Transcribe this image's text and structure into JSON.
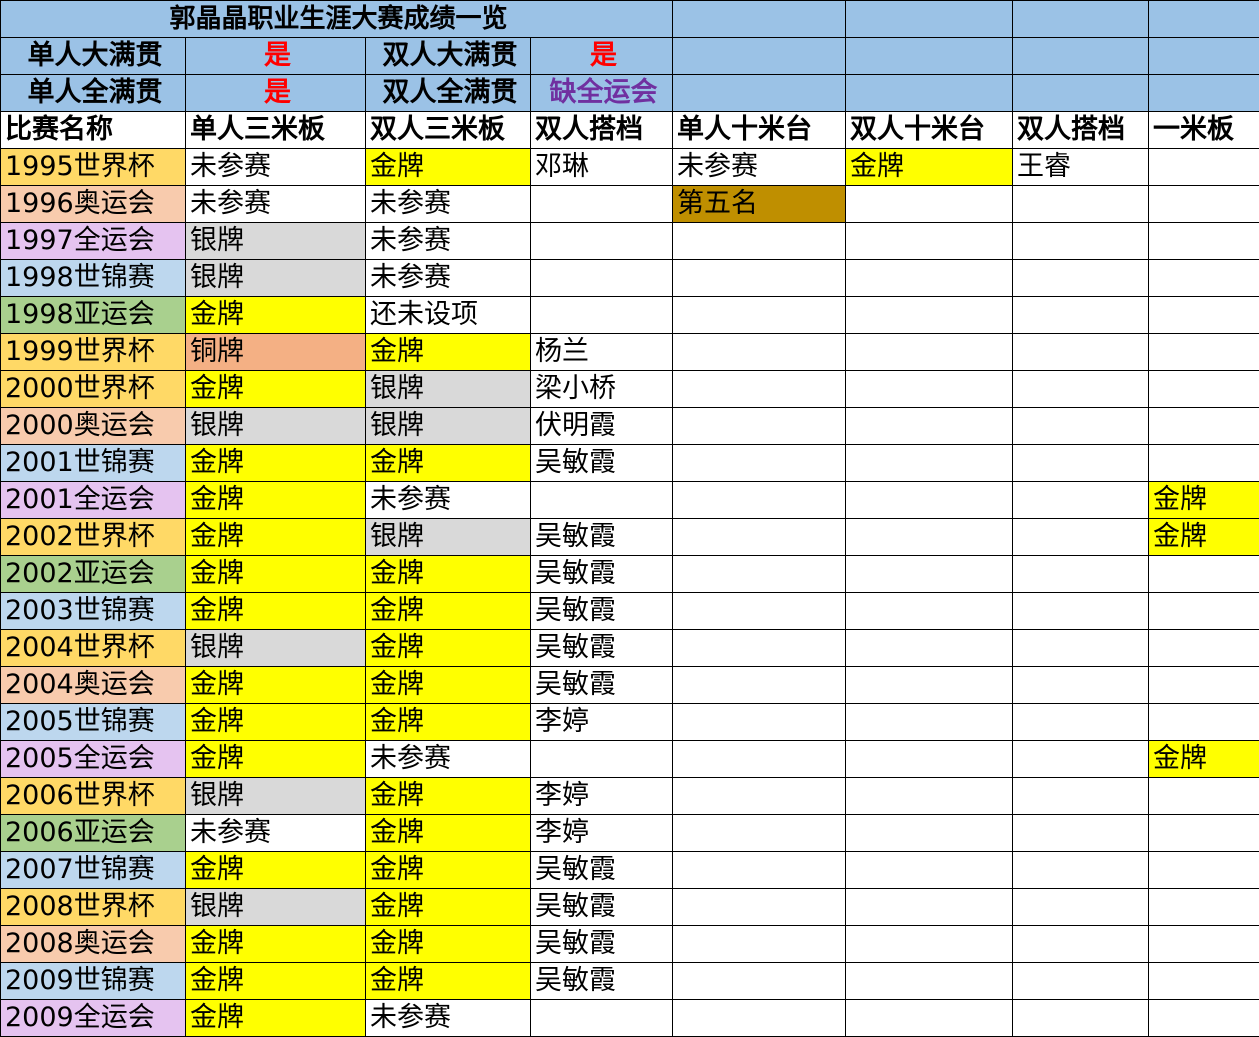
{
  "title": "郭晶晶职业生涯大赛成绩一览",
  "summary": [
    {
      "label1": "单人大满贯",
      "value1": "是",
      "label2": "双人大满贯",
      "value2": "是",
      "value2_color": "red"
    },
    {
      "label1": "单人全满贯",
      "value1": "是",
      "label2": "双人全满贯",
      "value2": "缺全运会",
      "value2_color": "purple"
    }
  ],
  "columns": [
    "比赛名称",
    "单人三米板",
    "双人三米板",
    "双人搭档",
    "单人十米台",
    "双人十米台",
    "双人搭档",
    "一米板"
  ],
  "colors": {
    "header_blue": "#9bc2e6",
    "gold": "#ffff00",
    "silver": "#d9d9d9",
    "bronze": "#f4b084",
    "fifth": "#bf8f00",
    "world_cup": "#ffd966",
    "olympics": "#f8cbad",
    "national_games": "#e5c3f0",
    "world_championships": "#bdd7ee",
    "asian_games": "#a9d08e"
  },
  "rows": [
    {
      "event": "1995世界杯",
      "cells": [
        "未参赛",
        "金牌",
        "邓琳",
        "未参赛",
        "金牌",
        "王睿",
        ""
      ]
    },
    {
      "event": "1996奥运会",
      "cells": [
        "未参赛",
        "未参赛",
        "",
        "第五名",
        "",
        "",
        ""
      ]
    },
    {
      "event": "1997全运会",
      "cells": [
        "银牌",
        "未参赛",
        "",
        "",
        "",
        "",
        ""
      ]
    },
    {
      "event": "1998世锦赛",
      "cells": [
        "银牌",
        "未参赛",
        "",
        "",
        "",
        "",
        ""
      ]
    },
    {
      "event": "1998亚运会",
      "cells": [
        "金牌",
        "还未设项",
        "",
        "",
        "",
        "",
        ""
      ]
    },
    {
      "event": "1999世界杯",
      "cells": [
        "铜牌",
        "金牌",
        "杨兰",
        "",
        "",
        "",
        ""
      ]
    },
    {
      "event": "2000世界杯",
      "cells": [
        "金牌",
        "银牌",
        "梁小桥",
        "",
        "",
        "",
        ""
      ]
    },
    {
      "event": "2000奥运会",
      "cells": [
        "银牌",
        "银牌",
        "伏明霞",
        "",
        "",
        "",
        ""
      ]
    },
    {
      "event": "2001世锦赛",
      "cells": [
        "金牌",
        "金牌",
        "吴敏霞",
        "",
        "",
        "",
        ""
      ]
    },
    {
      "event": "2001全运会",
      "cells": [
        "金牌",
        "未参赛",
        "",
        "",
        "",
        "",
        "金牌"
      ]
    },
    {
      "event": "2002世界杯",
      "cells": [
        "金牌",
        "银牌",
        "吴敏霞",
        "",
        "",
        "",
        "金牌"
      ]
    },
    {
      "event": "2002亚运会",
      "cells": [
        "金牌",
        "金牌",
        "吴敏霞",
        "",
        "",
        "",
        ""
      ]
    },
    {
      "event": "2003世锦赛",
      "cells": [
        "金牌",
        "金牌",
        "吴敏霞",
        "",
        "",
        "",
        ""
      ]
    },
    {
      "event": "2004世界杯",
      "cells": [
        "银牌",
        "金牌",
        "吴敏霞",
        "",
        "",
        "",
        ""
      ]
    },
    {
      "event": "2004奥运会",
      "cells": [
        "金牌",
        "金牌",
        "吴敏霞",
        "",
        "",
        "",
        ""
      ]
    },
    {
      "event": "2005世锦赛",
      "cells": [
        "金牌",
        "金牌",
        "李婷",
        "",
        "",
        "",
        ""
      ]
    },
    {
      "event": "2005全运会",
      "cells": [
        "金牌",
        "未参赛",
        "",
        "",
        "",
        "",
        "金牌"
      ]
    },
    {
      "event": "2006世界杯",
      "cells": [
        "银牌",
        "金牌",
        "李婷",
        "",
        "",
        "",
        ""
      ]
    },
    {
      "event": "2006亚运会",
      "cells": [
        "未参赛",
        "金牌",
        "李婷",
        "",
        "",
        "",
        ""
      ]
    },
    {
      "event": "2007世锦赛",
      "cells": [
        "金牌",
        "金牌",
        "吴敏霞",
        "",
        "",
        "",
        ""
      ]
    },
    {
      "event": "2008世界杯",
      "cells": [
        "银牌",
        "金牌",
        "吴敏霞",
        "",
        "",
        "",
        ""
      ]
    },
    {
      "event": "2008奥运会",
      "cells": [
        "金牌",
        "金牌",
        "吴敏霞",
        "",
        "",
        "",
        ""
      ]
    },
    {
      "event": "2009世锦赛",
      "cells": [
        "金牌",
        "金牌",
        "吴敏霞",
        "",
        "",
        "",
        ""
      ]
    },
    {
      "event": "2009全运会",
      "cells": [
        "金牌",
        "未参赛",
        "",
        "",
        "",
        "",
        ""
      ]
    }
  ]
}
